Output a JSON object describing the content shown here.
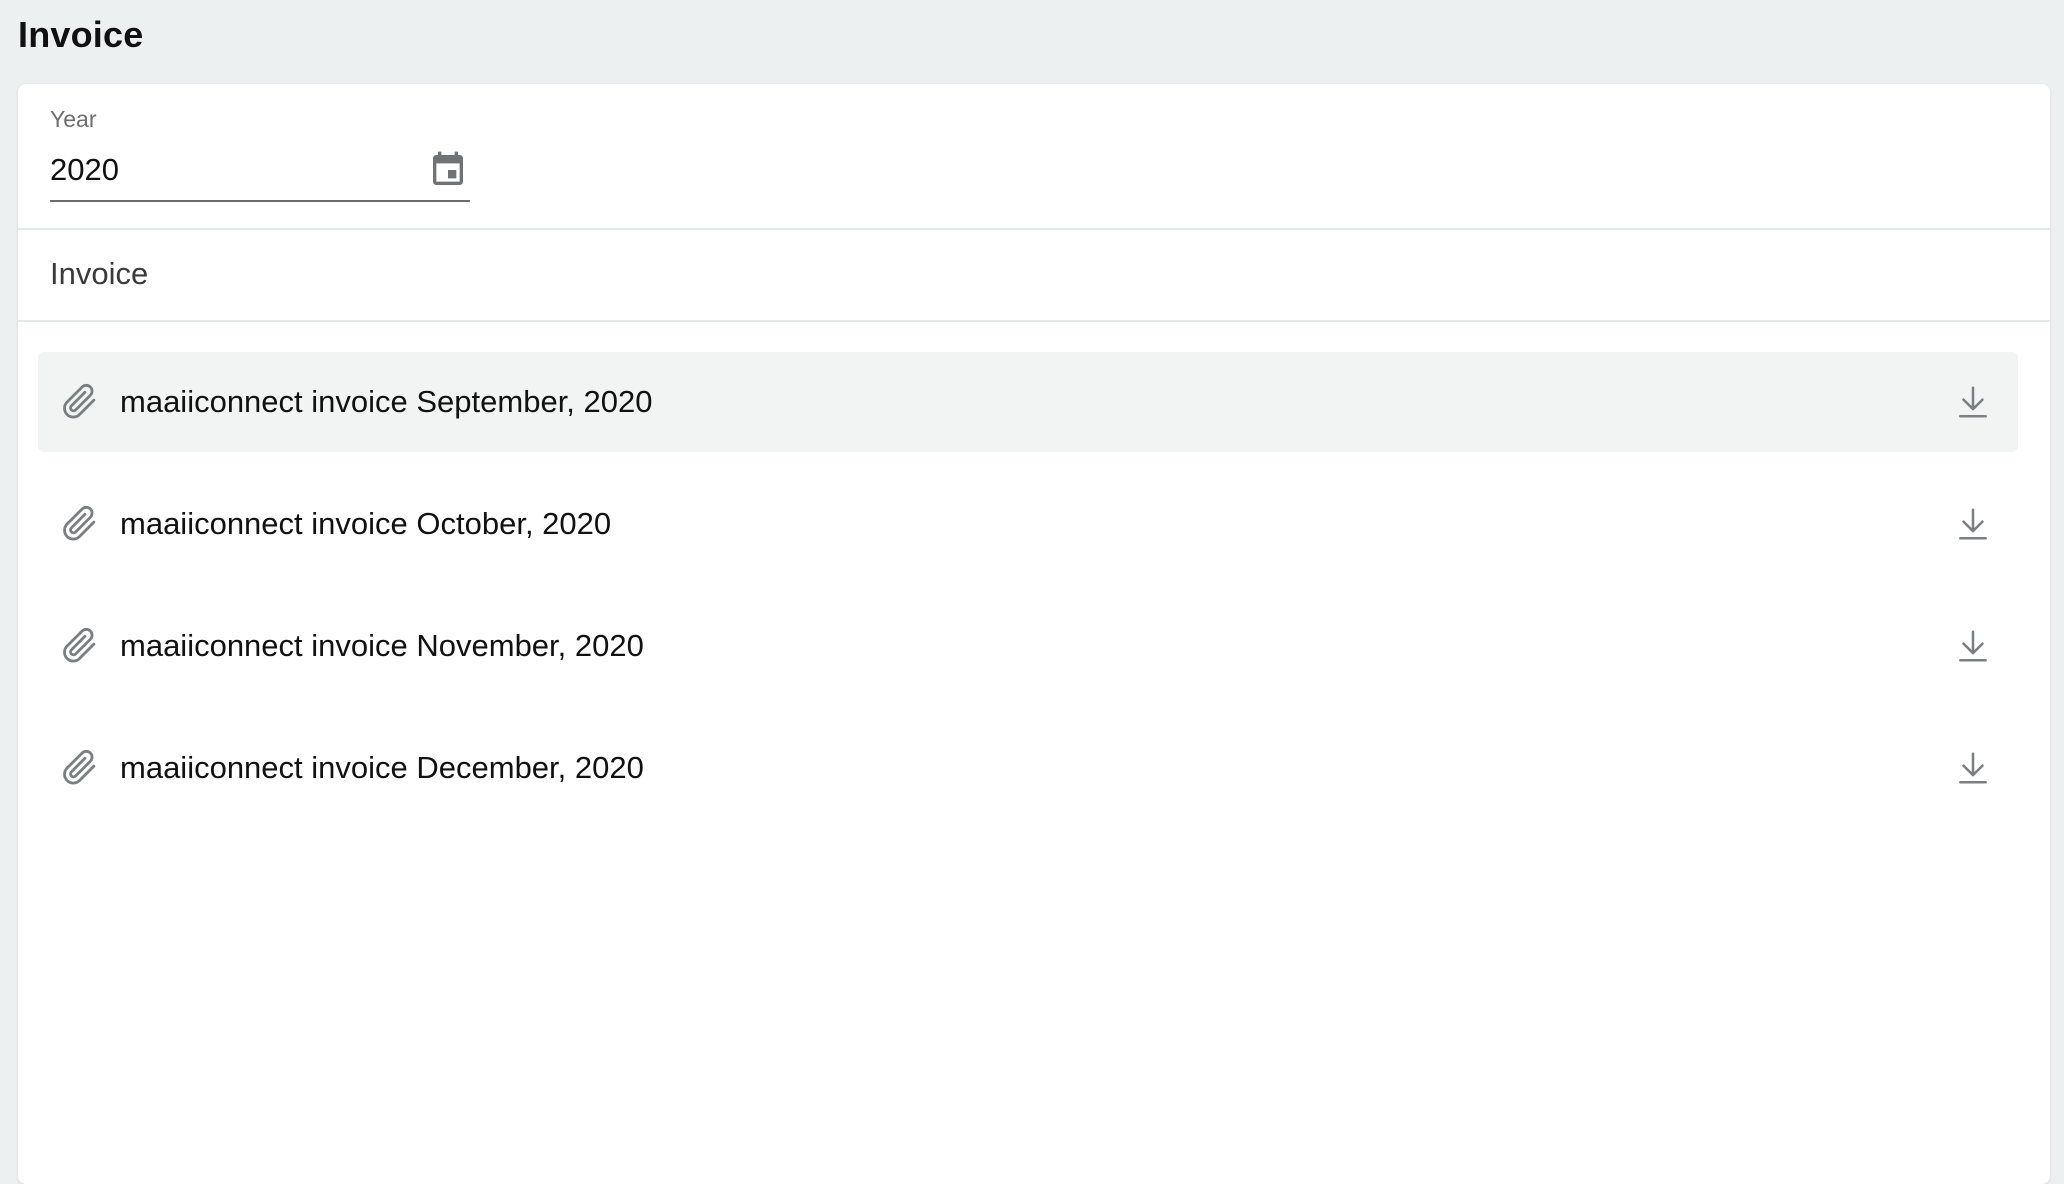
{
  "page": {
    "title": "Invoice"
  },
  "filter": {
    "year_label": "Year",
    "year_value": "2020",
    "calendar_icon": "calendar-icon"
  },
  "section": {
    "title": "Invoice"
  },
  "invoices": [
    {
      "label": "maaiiconnect invoice September, 2020",
      "icon": "paperclip-icon",
      "action_icon": "download-icon",
      "selected": true
    },
    {
      "label": "maaiiconnect invoice October, 2020",
      "icon": "paperclip-icon",
      "action_icon": "download-icon",
      "selected": false
    },
    {
      "label": "maaiiconnect invoice November, 2020",
      "icon": "paperclip-icon",
      "action_icon": "download-icon",
      "selected": false
    },
    {
      "label": "maaiiconnect invoice December, 2020",
      "icon": "paperclip-icon",
      "action_icon": "download-icon",
      "selected": false
    }
  ],
  "colors": {
    "background": "#edf0f1",
    "card": "#ffffff",
    "selected_row": "#f2f4f4",
    "icon": "#7a7f81"
  }
}
